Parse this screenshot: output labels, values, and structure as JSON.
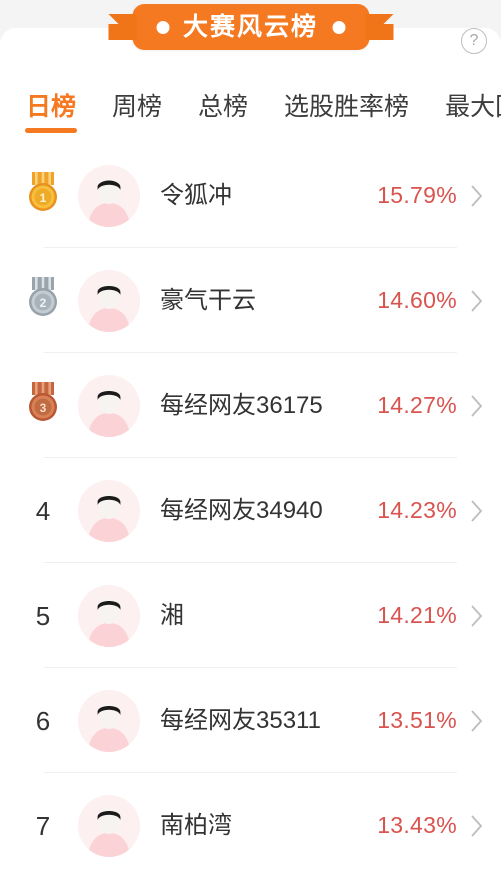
{
  "banner": {
    "title": "大赛风云榜",
    "left_dot": "dot",
    "right_dot": "dot",
    "color": "#f47920"
  },
  "help": {
    "label": "?"
  },
  "tabs": {
    "active_index": 0,
    "items": [
      {
        "label": "日榜"
      },
      {
        "label": "周榜"
      },
      {
        "label": "总榜"
      },
      {
        "label": "选股胜率榜"
      },
      {
        "label": "最大回撤"
      }
    ]
  },
  "list": {
    "value_color": "#d9534f",
    "rows": [
      {
        "rank": "1",
        "medal": "gold",
        "name": "令狐冲",
        "value": "15.79%"
      },
      {
        "rank": "2",
        "medal": "silver",
        "name": "豪气干云",
        "value": "14.60%"
      },
      {
        "rank": "3",
        "medal": "bronze",
        "name": "每经网友36175",
        "value": "14.27%"
      },
      {
        "rank": "4",
        "medal": "",
        "name": "每经网友34940",
        "value": "14.23%"
      },
      {
        "rank": "5",
        "medal": "",
        "name": "湘",
        "value": "14.21%"
      },
      {
        "rank": "6",
        "medal": "",
        "name": "每经网友35311",
        "value": "13.51%"
      },
      {
        "rank": "7",
        "medal": "",
        "name": "南柏湾",
        "value": "13.43%"
      }
    ]
  }
}
